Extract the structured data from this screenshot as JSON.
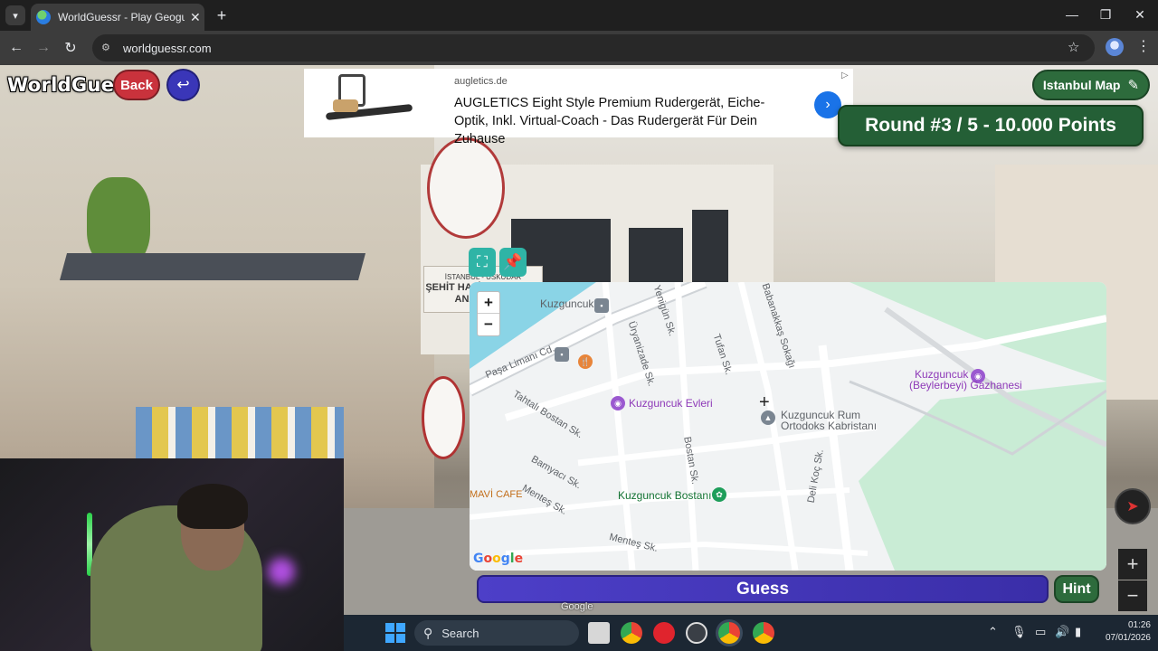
{
  "browser": {
    "tab_title": "WorldGuessr - Play Geoguessr",
    "tab_close": "✕",
    "new_tab": "+",
    "url": "worldguessr.com",
    "menu_icon": "chevron-down-icon"
  },
  "game": {
    "logo": "WorldGuessr",
    "back_label": "Back",
    "map_label": "Istanbul Map",
    "round_text": "Round #3 / 5 - 10.000 Points",
    "guess_label": "Guess",
    "hint_label": "Hint",
    "google_attribution": "Google"
  },
  "ad": {
    "domain": "augletics.de",
    "headline": "AUGLETICS Eight Style Premium Rudergerät, Eiche-Optik, Inkl. Virtual-Coach - Das Rudergerät Für Dein Zuhause"
  },
  "scene": {
    "sign_line1": "İSTANBUL - ÜSKÜDAR",
    "sign_line2": "ŞEHİT HALİL KANTARCI",
    "sign_line3": "ANAOKULU"
  },
  "minimap": {
    "zoom_in": "+",
    "zoom_out": "−",
    "labels": {
      "kuzguncuk": "Kuzguncuk",
      "pasa_limani": "Paşa Limanı Cd.",
      "tahtali_bostan": "Tahtalı Bostan Sk.",
      "uryanizade": "Üryanizade Sk.",
      "yenigun": "Yenigün Sk.",
      "tufan": "Tufan Sk.",
      "babanakkas": "Babanakkaş Sokağı",
      "evleri": "Kuzguncuk Evleri",
      "rum_kabristani_1": "Kuzguncuk Rum",
      "rum_kabristani_2": "Ortodoks Kabristanı",
      "gazhanesi_1": "Kuzguncuk",
      "gazhanesi_2": "(Beylerbeyi) Gazhanesi",
      "bamyaci": "Bamyacı Sk.",
      "mentes": "Menteş Sk.",
      "mentes2": "Menteş Sk.",
      "bostan": "Bostan Sk.",
      "bostani": "Kuzguncuk Bostanı",
      "mavi_cafe": "MAVİ CAFE",
      "deli_koc": "Deli Koç Sk.",
      "google": "Google"
    }
  },
  "taskbar": {
    "search_label": "Search",
    "time": "01:26",
    "date": "07/01/2026"
  },
  "colors": {
    "back": "#c9323c",
    "return": "#3a36b8",
    "round_banner": "#245f36",
    "guess": "#4d3fc8",
    "teal_tools": "#2fb4a6"
  }
}
